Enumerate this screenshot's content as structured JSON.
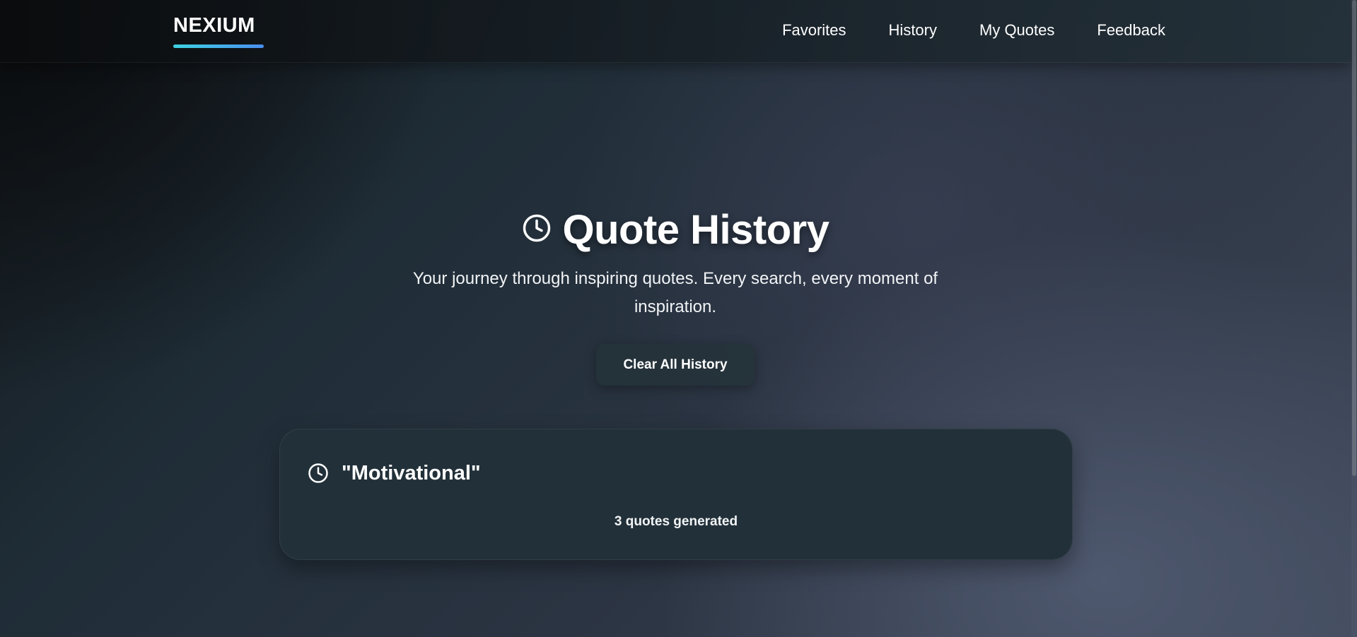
{
  "nav": {
    "logo": "NEXIUM",
    "links": [
      "Favorites",
      "History",
      "My Quotes",
      "Feedback"
    ]
  },
  "hero": {
    "icon": "clock-icon",
    "title": "Quote History",
    "subtitle": "Your journey through inspiring quotes. Every search, every moment of inspiration.",
    "clear_button": "Clear All History"
  },
  "history": {
    "items": [
      {
        "icon": "clock-icon",
        "title": "\"Motivational\"",
        "count": "3 quotes generated"
      }
    ]
  },
  "colors": {
    "accent_gradient_start": "#3dd2e0",
    "accent_gradient_end": "#4a8ff0",
    "card_bg": "#223039",
    "text": "#ffffff"
  }
}
